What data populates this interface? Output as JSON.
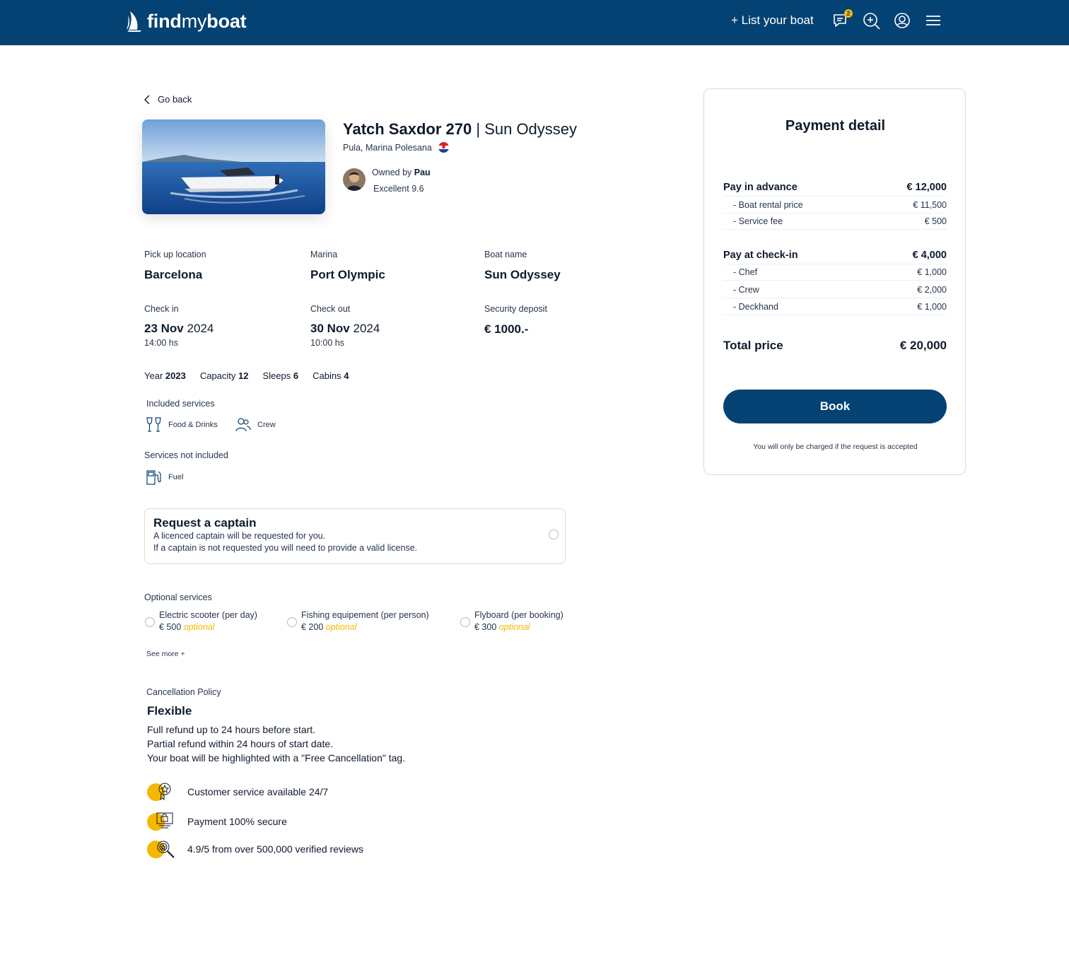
{
  "header": {
    "logo_bold1": "find",
    "logo_light": "my",
    "logo_bold2": "boat",
    "list_boat": "+ List your boat",
    "messages_badge": "2",
    "icons": [
      "messages-icon",
      "search-plus-icon",
      "account-icon",
      "menu-icon"
    ],
    "brand_color": "#044273",
    "accent_color": "#f5b800"
  },
  "back": {
    "label": "Go back"
  },
  "boat": {
    "title": "Yatch Saxdor 270",
    "separator": "|",
    "model": "Sun Odyssey",
    "location": "Pula, Marina Polesana",
    "owner_prefix": "Owned by",
    "owner_name": "Pau",
    "rating": "Excellent 9.6"
  },
  "details": {
    "pickup_label": "Pick up location",
    "pickup_value": "Barcelona",
    "marina_label": "Marina",
    "marina_value": "Port Olympic",
    "boatname_label": "Boat name",
    "boatname_value": "Sun Odyssey",
    "checkin_label": "Check in",
    "checkin_date_bold": "23 Nov",
    "checkin_year": "2024",
    "checkin_time": "14:00 hs",
    "checkout_label": "Check out",
    "checkout_date_bold": "30 Nov",
    "checkout_year": "2024",
    "checkout_time": "10:00 hs",
    "deposit_label": "Security deposit",
    "deposit_value": "€ 1000.-"
  },
  "specs": {
    "year_label": "Year",
    "year_value": "2023",
    "capacity_label": "Capacity",
    "capacity_value": "12",
    "sleeps_label": "Sleeps",
    "sleeps_value": "6",
    "cabins_label": "Cabins",
    "cabins_value": "4"
  },
  "included": {
    "label": "Included services",
    "items": [
      "Food & Drinks",
      "Crew"
    ]
  },
  "not_included": {
    "label": "Services not included",
    "items": [
      "Fuel"
    ]
  },
  "captain": {
    "title": "Request a captain",
    "line1": "A licenced captain will be requested for you.",
    "line2": "If a captain is not requested you will need to provide a valid license."
  },
  "optional": {
    "label": "Optional services",
    "items": [
      {
        "name": "Electric scooter (per day)",
        "price": "€ 500",
        "tag": "optional"
      },
      {
        "name": "Fishing equipement (per person)",
        "price": "€ 200",
        "tag": "optional"
      },
      {
        "name": "Flyboard (per booking)",
        "price": "€ 300",
        "tag": "optional"
      }
    ],
    "see_more": "See more +"
  },
  "policy": {
    "label": "Cancellation Policy",
    "name": "Flexible",
    "lines": [
      "Full refund up to 24 hours before start.",
      "Partial refund within 24 hours of start date.",
      "Your boat will be highlighted with a \"Free Cancellation\" tag."
    ]
  },
  "trust": [
    "Customer service available 24/7",
    "Payment 100% secure",
    "4.9/5 from over 500,000 verified reviews"
  ],
  "payment": {
    "title": "Payment detail",
    "advance_label": "Pay in advance",
    "advance_total": "€ 12,000",
    "advance_items": [
      {
        "label": "- Boat rental price",
        "value": "€ 11,500"
      },
      {
        "label": "- Service fee",
        "value": "€ 500"
      }
    ],
    "checkin_label": "Pay at check-in",
    "checkin_total": "€ 4,000",
    "checkin_items": [
      {
        "label": "- Chef",
        "value": "€ 1,000"
      },
      {
        "label": "- Crew",
        "value": "€ 2,000"
      },
      {
        "label": "- Deckhand",
        "value": "€ 1,000"
      }
    ],
    "total_label": "Total price",
    "total_value": "€ 20,000",
    "book_label": "Book",
    "note": "You will only be charged if the request is accepted"
  }
}
